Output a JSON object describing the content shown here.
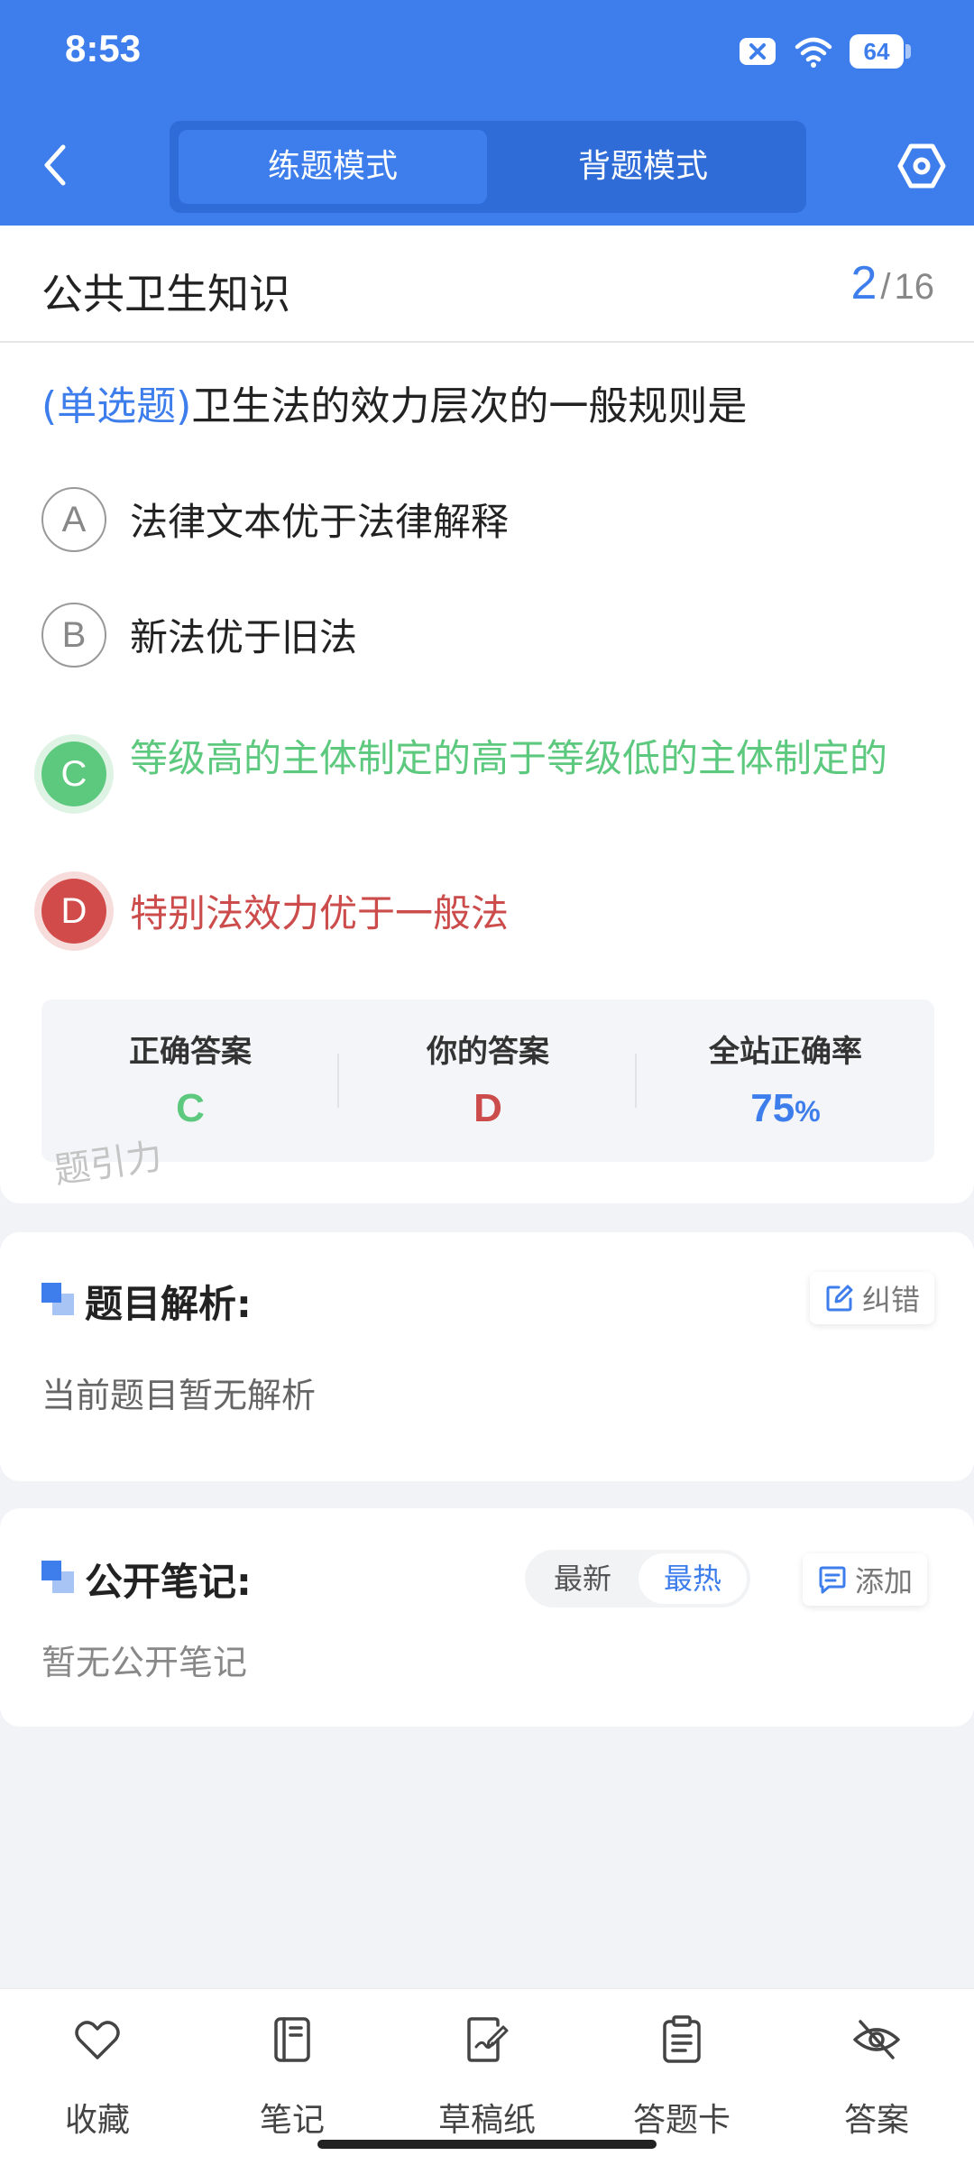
{
  "status_bar": {
    "time": "8:53",
    "battery": "64"
  },
  "header": {
    "modes": [
      {
        "label": "练题模式",
        "active": true
      },
      {
        "label": "背题模式",
        "active": false
      }
    ]
  },
  "subject": {
    "title": "公共卫生知识",
    "current": "2",
    "separator": "/",
    "total": "16"
  },
  "question": {
    "type": "(单选题)",
    "text": "卫生法的效力层次的一般规则是",
    "options": [
      {
        "letter": "A",
        "text": "法律文本优于法律解释",
        "state": "normal"
      },
      {
        "letter": "B",
        "text": "新法优于旧法",
        "state": "normal"
      },
      {
        "letter": "C",
        "text": "等级高的主体制定的高于等级低的主体制定的",
        "state": "correct"
      },
      {
        "letter": "D",
        "text": "特别法效力优于一般法",
        "state": "wrong"
      }
    ]
  },
  "answer_summary": {
    "correct_label": "正确答案",
    "correct_value": "C",
    "yours_label": "你的答案",
    "yours_value": "D",
    "rate_label": "全站正确率",
    "rate_value": "75",
    "rate_unit": "%"
  },
  "watermark": "题引力",
  "analysis": {
    "title": "题目解析:",
    "body": "当前题目暂无解析",
    "report_label": "纠错"
  },
  "notes": {
    "title": "公开笔记:",
    "sort_latest": "最新",
    "sort_hot": "最热",
    "add_label": "添加",
    "body": "暂无公开笔记"
  },
  "bottom_nav": [
    {
      "label": "收藏",
      "icon": "heart-icon"
    },
    {
      "label": "笔记",
      "icon": "notebook-icon"
    },
    {
      "label": "草稿纸",
      "icon": "draft-paper-icon"
    },
    {
      "label": "答题卡",
      "icon": "answer-sheet-icon"
    },
    {
      "label": "答案",
      "icon": "eye-off-icon"
    }
  ],
  "colors": {
    "primary": "#3d7eec",
    "correct": "#5cc97e",
    "wrong": "#cc4b4b"
  }
}
